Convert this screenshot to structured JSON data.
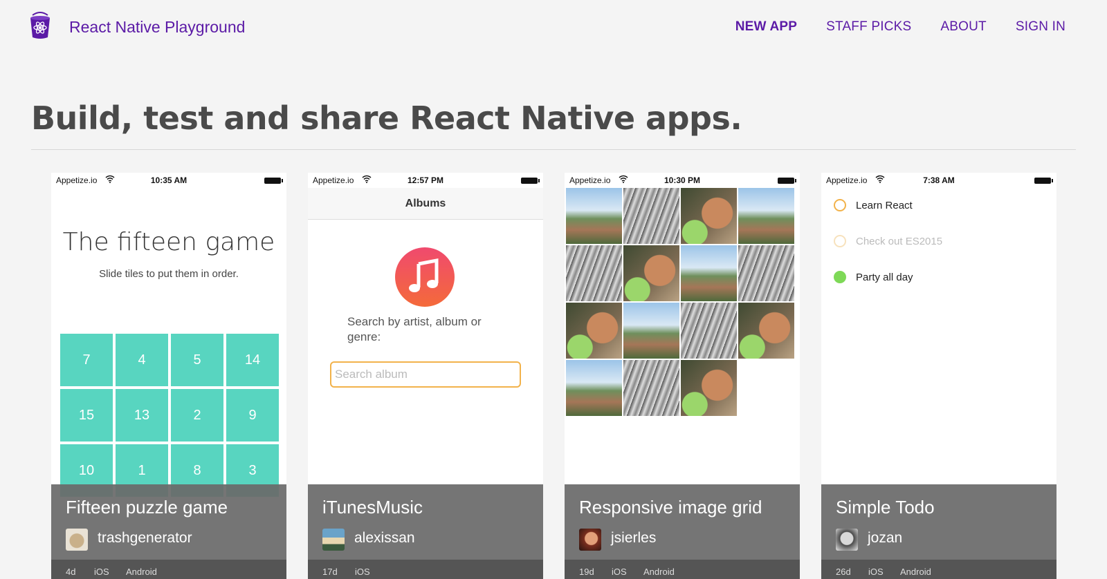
{
  "header": {
    "brand": "React Native Playground",
    "nav": [
      "NEW APP",
      "STAFF PICKS",
      "ABOUT",
      "SIGN IN"
    ]
  },
  "hero": "Build, test and share React Native apps.",
  "colors": {
    "brand": "#5b1aa6",
    "tile": "#58d5c0",
    "input_border": "#f2b24a",
    "todo_done": "#7ed957",
    "todo_open": "#f2b24a"
  },
  "cards": [
    {
      "carrier": "Appetize.io",
      "time": "10:35 AM",
      "app_title": "The fifteen game",
      "app_subtitle": "Slide tiles to put them in order.",
      "tiles": [
        "7",
        "4",
        "5",
        "14",
        "15",
        "13",
        "2",
        "9",
        "10",
        "1",
        "8",
        "3"
      ],
      "title": "Fifteen puzzle game",
      "author": "trashgenerator",
      "age": "4d",
      "platforms": [
        "iOS",
        "Android"
      ]
    },
    {
      "carrier": "Appetize.io",
      "time": "12:57 PM",
      "nav_title": "Albums",
      "prompt": "Search by artist, album or genre:",
      "placeholder": "Search album",
      "title": "iTunesMusic",
      "author": "alexissan",
      "age": "17d",
      "platforms": [
        "iOS"
      ]
    },
    {
      "carrier": "Appetize.io",
      "time": "10:30 PM",
      "title": "Responsive image grid",
      "author": "jsierles",
      "age": "19d",
      "platforms": [
        "iOS",
        "Android"
      ]
    },
    {
      "carrier": "Appetize.io",
      "time": "7:38 AM",
      "todos": [
        {
          "text": "Learn React",
          "state": "open"
        },
        {
          "text": "Check out ES2015",
          "state": "faded"
        },
        {
          "text": "Party all day",
          "state": "done"
        }
      ],
      "title": "Simple Todo",
      "author": "jozan",
      "age": "26d",
      "platforms": [
        "iOS",
        "Android"
      ]
    }
  ]
}
